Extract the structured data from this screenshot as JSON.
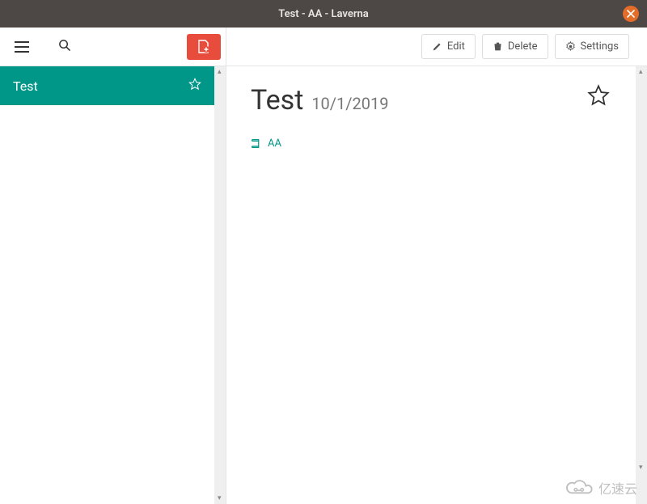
{
  "window": {
    "title": "Test - AA - Laverna"
  },
  "sidebar": {
    "items": [
      {
        "title": "Test"
      }
    ]
  },
  "toolbar": {
    "edit": "Edit",
    "delete": "Delete",
    "settings": "Settings"
  },
  "note": {
    "title": "Test",
    "date": "10/1/2019",
    "notebook": "AA"
  },
  "watermark": {
    "text": "亿速云"
  },
  "colors": {
    "accent": "#009688",
    "danger": "#e74c3c"
  }
}
